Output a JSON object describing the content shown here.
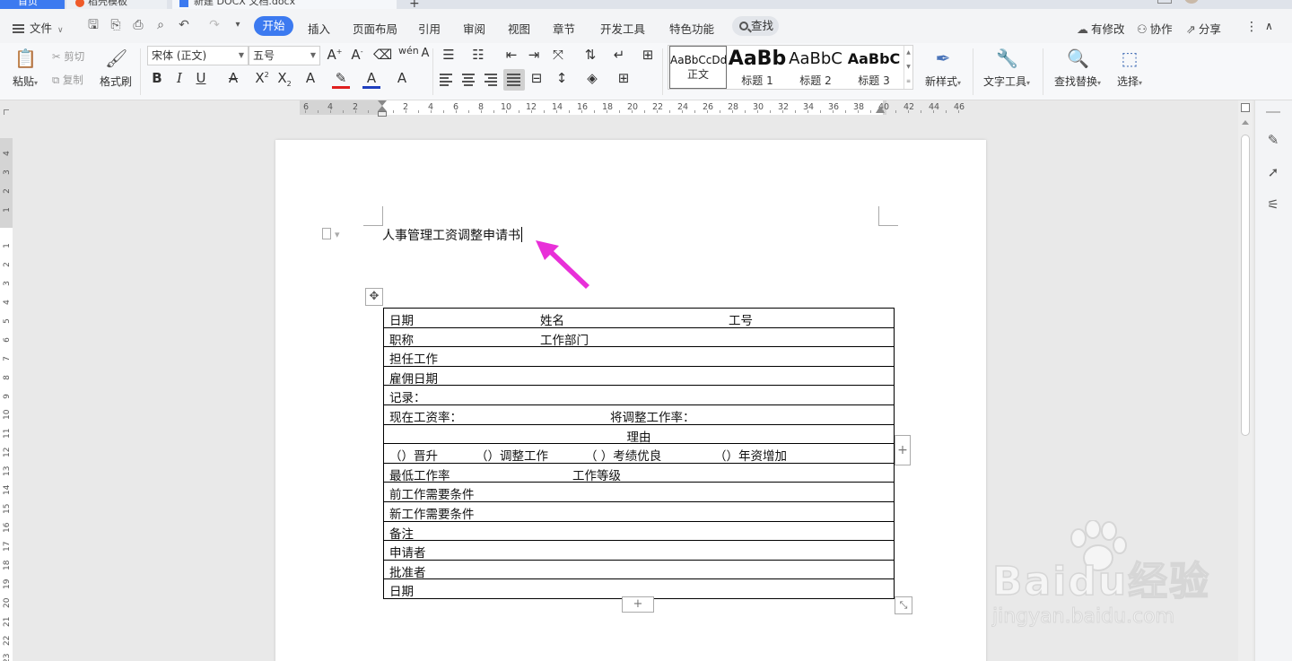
{
  "tabs": {
    "home": "首页",
    "daoke": "稻壳模板",
    "doc": "新建 DOCX 文档.docx",
    "new_tab": "+"
  },
  "menu": {
    "file": "文件",
    "items": [
      "开始",
      "插入",
      "页面布局",
      "引用",
      "审阅",
      "视图",
      "章节",
      "开发工具",
      "特色功能"
    ],
    "search": "查找",
    "right": [
      "有修改",
      "协作",
      "分享"
    ]
  },
  "ribbon": {
    "paste": "粘贴",
    "cut": "剪切",
    "copy": "复制",
    "format_painter": "格式刷",
    "font_name": "宋体 (正文)",
    "font_size": "五号",
    "styles": [
      {
        "preview": "AaBbCcDd",
        "name": "正文"
      },
      {
        "preview": "AaBb",
        "name": "标题 1"
      },
      {
        "preview": "AaBbC",
        "name": "标题 2"
      },
      {
        "preview": "AaBbC",
        "name": "标题 3"
      }
    ],
    "new_style": "新样式",
    "text_tools": "文字工具",
    "find_replace": "查找替换",
    "select": "选择"
  },
  "ruler": {
    "h_labels": [
      "6",
      "4",
      "2",
      "2",
      "4",
      "6",
      "8",
      "10",
      "12",
      "14",
      "16",
      "18",
      "20",
      "22",
      "24",
      "26",
      "28",
      "30",
      "32",
      "34",
      "36",
      "38",
      "40",
      "42",
      "44",
      "46"
    ],
    "v_labels": [
      "4",
      "3",
      "2",
      "1",
      "1",
      "2",
      "3",
      "4",
      "5",
      "6",
      "7",
      "8",
      "9",
      "10",
      "11",
      "12",
      "13",
      "14",
      "15",
      "16",
      "17",
      "18",
      "19",
      "20",
      "21",
      "22",
      "23"
    ]
  },
  "document": {
    "title": "人事管理工资调整申请书",
    "rows": [
      {
        "cells": [
          "日期",
          "姓名",
          "工号"
        ]
      },
      {
        "cells": [
          "职称",
          "工作部门"
        ]
      },
      {
        "cells": [
          "担任工作"
        ]
      },
      {
        "cells": [
          "雇佣日期"
        ]
      },
      {
        "cells": [
          "记录："
        ]
      },
      {
        "cells": [
          "现在工资率：",
          "将调整工作率："
        ]
      },
      {
        "cells": [
          "理由"
        ]
      },
      {
        "cells": [
          "（）晋升",
          "（）调整工作",
          "（ ）考绩优良",
          "（）年资增加"
        ]
      },
      {
        "cells": [
          "最低工作率",
          "工作等级"
        ]
      },
      {
        "cells": [
          "前工作需要条件"
        ]
      },
      {
        "cells": [
          "新工作需要条件"
        ]
      },
      {
        "cells": [
          "备注"
        ]
      },
      {
        "cells": [
          "申请者"
        ]
      },
      {
        "cells": [
          "批准者"
        ]
      },
      {
        "cells": [
          "日期"
        ]
      }
    ]
  },
  "watermark": {
    "brand": "Baidu经验",
    "url": "jingyan.baidu.com"
  },
  "colors": {
    "accent": "#3c7af0",
    "arrow": "#e830d8"
  }
}
